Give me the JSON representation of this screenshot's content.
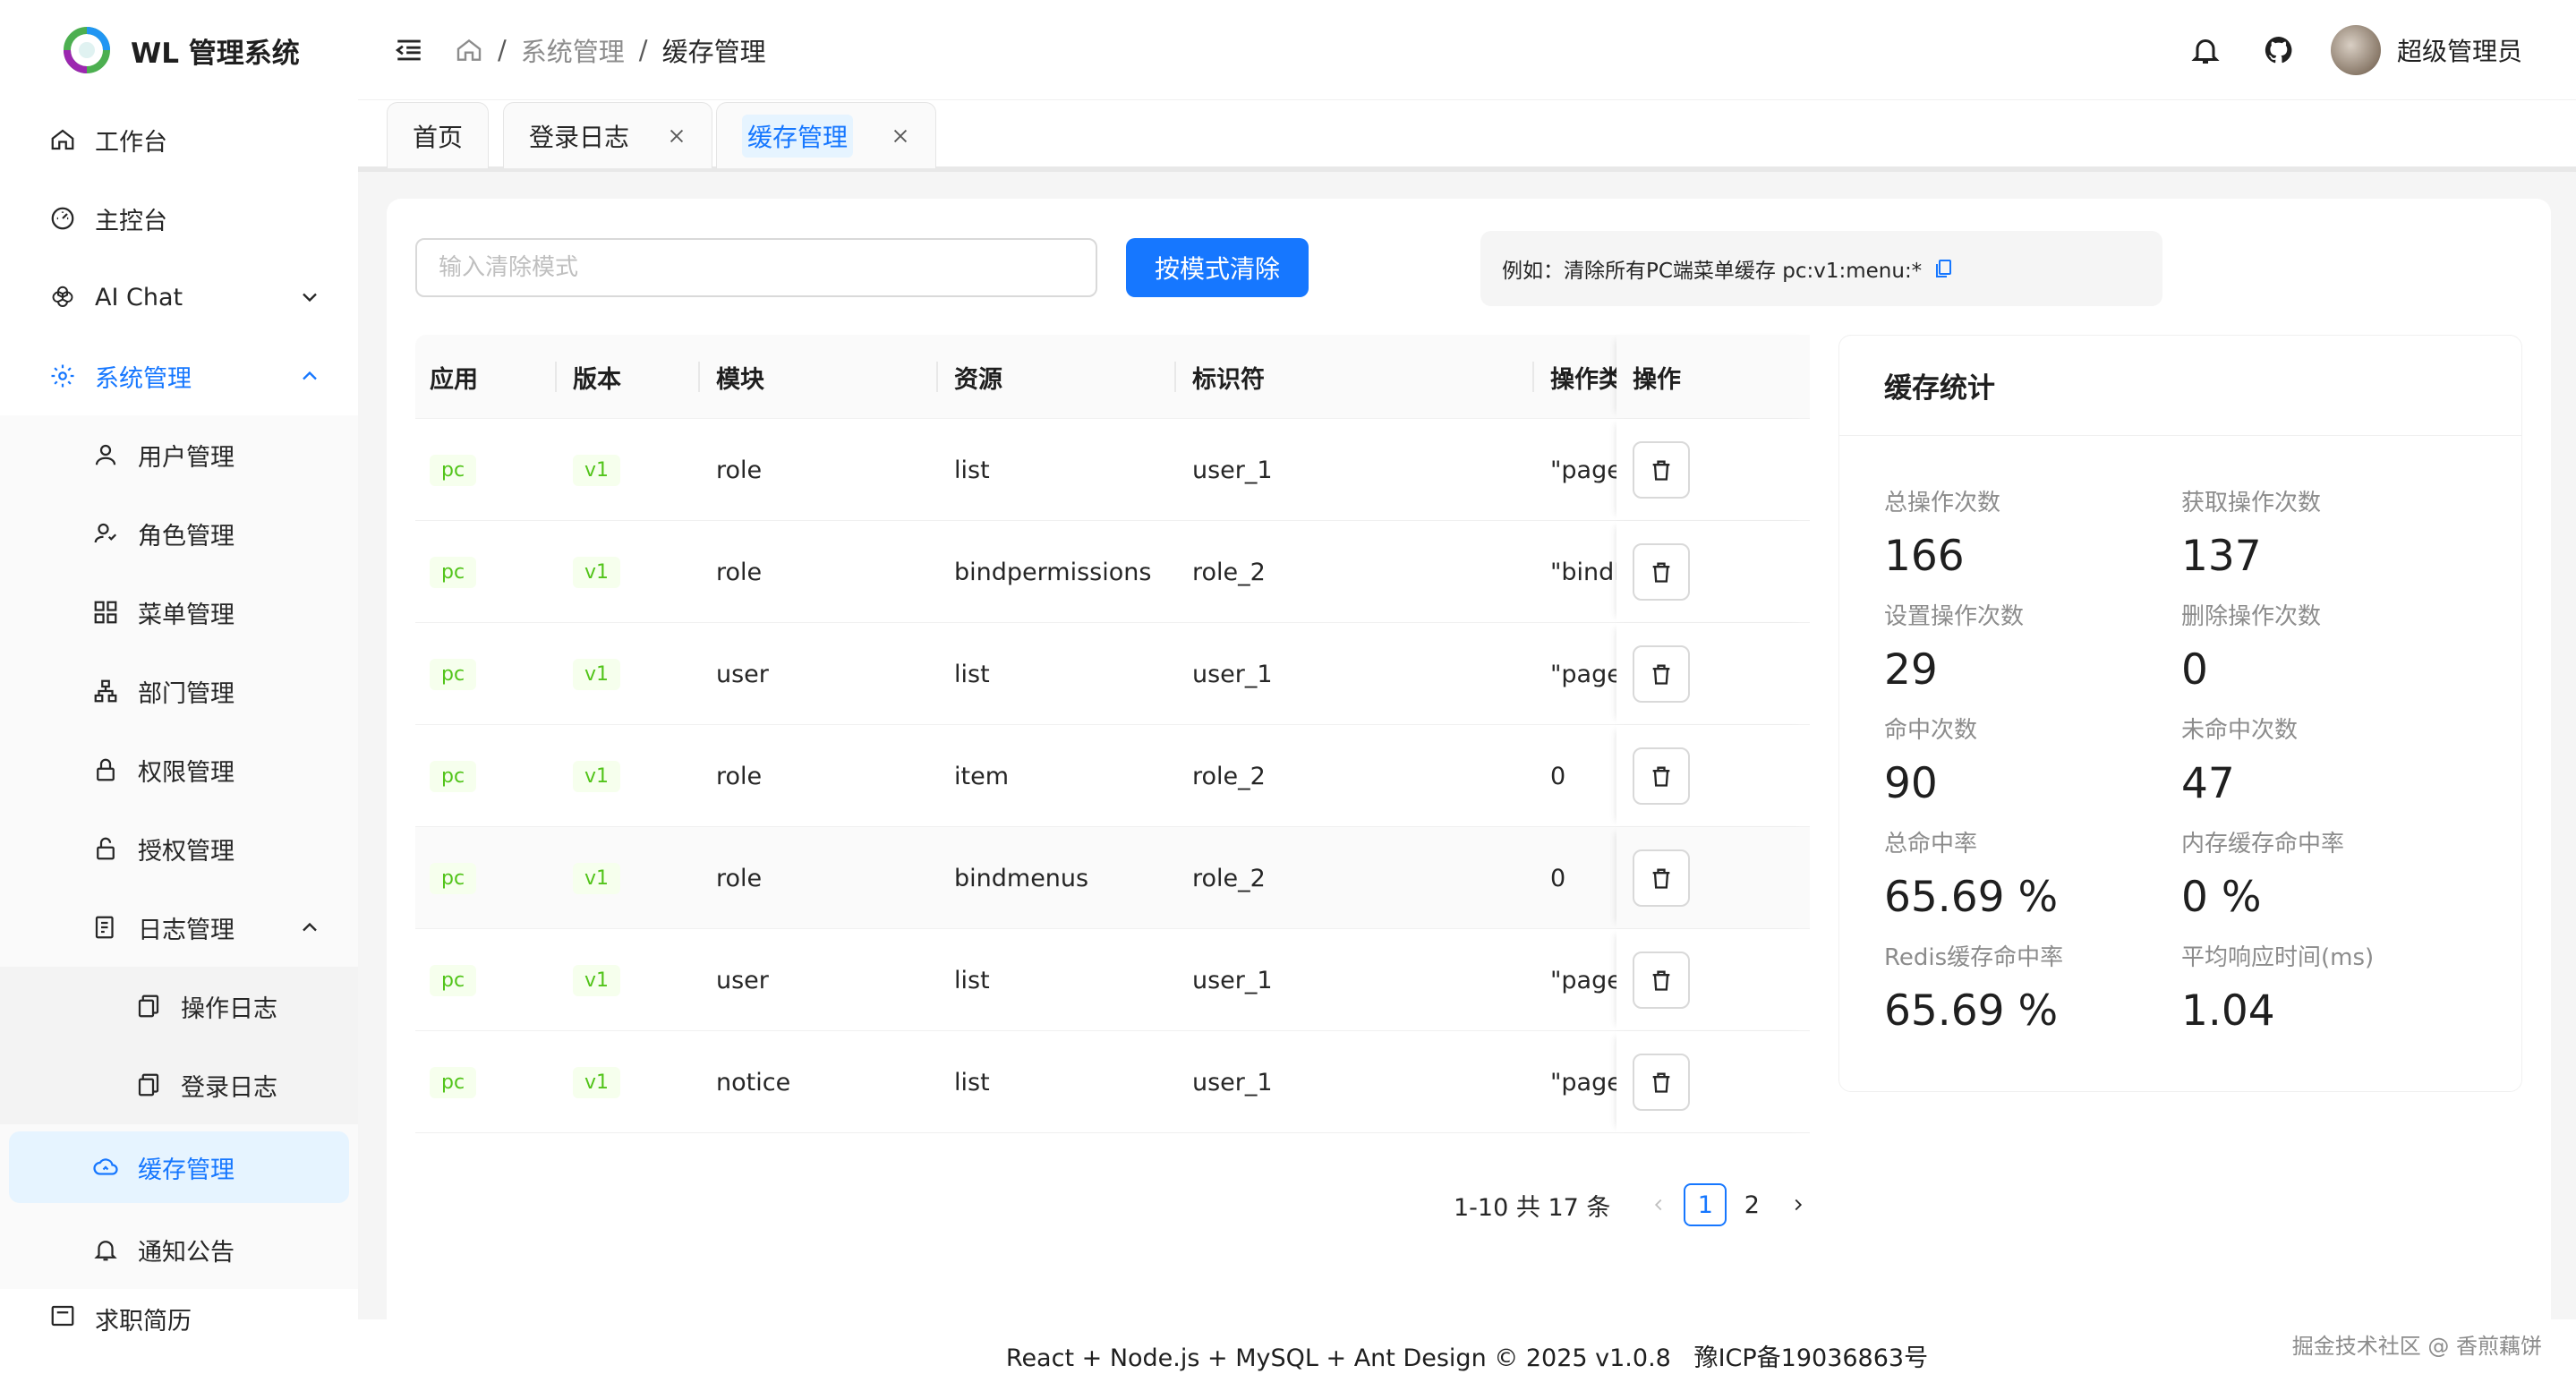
{
  "app": {
    "title": "WL 管理系统"
  },
  "sidebar": {
    "items": [
      {
        "label": "工作台",
        "icon": "home-icon"
      },
      {
        "label": "主控台",
        "icon": "dashboard-icon"
      },
      {
        "label": "AI Chat",
        "icon": "openai-icon"
      },
      {
        "label": "系统管理",
        "icon": "gear-icon"
      }
    ],
    "system": [
      {
        "label": "用户管理",
        "icon": "user-icon"
      },
      {
        "label": "角色管理",
        "icon": "role-icon"
      },
      {
        "label": "菜单管理",
        "icon": "menu-grid-icon"
      },
      {
        "label": "部门管理",
        "icon": "department-icon"
      },
      {
        "label": "权限管理",
        "icon": "lock-icon"
      },
      {
        "label": "授权管理",
        "icon": "unlock-icon"
      },
      {
        "label": "日志管理",
        "icon": "log-icon"
      }
    ],
    "logs": [
      {
        "label": "操作日志",
        "icon": "copy-doc-icon"
      },
      {
        "label": "登录日志",
        "icon": "copy-doc-icon"
      }
    ],
    "cache": {
      "label": "缓存管理",
      "icon": "cloud-icon"
    },
    "notice": {
      "label": "通知公告",
      "icon": "bell-icon"
    },
    "resume": {
      "label": "求职简历",
      "icon": "resume-icon"
    }
  },
  "header": {
    "breadcrumb": [
      "系统管理",
      "缓存管理"
    ],
    "username": "超级管理员"
  },
  "tabs": [
    {
      "label": "首页"
    },
    {
      "label": "登录日志"
    },
    {
      "label": "缓存管理"
    }
  ],
  "toolbar": {
    "search_placeholder": "输入清除模式",
    "clear_label": "按模式清除",
    "example": "例如：清除所有PC端菜单缓存 pc:v1:menu:*"
  },
  "table": {
    "columns": [
      "应用",
      "版本",
      "模块",
      "资源",
      "标识符",
      "操作类",
      "操作"
    ],
    "rows": [
      {
        "app": "pc",
        "version": "v1",
        "module": "role",
        "resource": "list",
        "id": "user_1",
        "op": "\"page"
      },
      {
        "app": "pc",
        "version": "v1",
        "module": "role",
        "resource": "bindpermissions",
        "id": "role_2",
        "op": "\"bindI"
      },
      {
        "app": "pc",
        "version": "v1",
        "module": "user",
        "resource": "list",
        "id": "user_1",
        "op": "\"page"
      },
      {
        "app": "pc",
        "version": "v1",
        "module": "role",
        "resource": "item",
        "id": "role_2",
        "op": "0"
      },
      {
        "app": "pc",
        "version": "v1",
        "module": "role",
        "resource": "bindmenus",
        "id": "role_2",
        "op": "0"
      },
      {
        "app": "pc",
        "version": "v1",
        "module": "user",
        "resource": "list",
        "id": "user_1",
        "op": "\"page"
      },
      {
        "app": "pc",
        "version": "v1",
        "module": "notice",
        "resource": "list",
        "id": "user_1",
        "op": "\"page"
      }
    ]
  },
  "pagination": {
    "total_text": "1-10 共 17 条",
    "pages": [
      "1",
      "2"
    ],
    "current": "1"
  },
  "stats": {
    "title": "缓存统计",
    "items": [
      {
        "label": "总操作次数",
        "value": "166"
      },
      {
        "label": "获取操作次数",
        "value": "137"
      },
      {
        "label": "设置操作次数",
        "value": "29"
      },
      {
        "label": "删除操作次数",
        "value": "0"
      },
      {
        "label": "命中次数",
        "value": "90"
      },
      {
        "label": "未命中次数",
        "value": "47"
      },
      {
        "label": "总命中率",
        "value": "65.69 %"
      },
      {
        "label": "内存缓存命中率",
        "value": "0 %"
      },
      {
        "label": "Redis缓存命中率",
        "value": "65.69 %"
      },
      {
        "label": "平均响应时间(ms)",
        "value": "1.04"
      }
    ]
  },
  "footer": {
    "text": "React + Node.js + MySQL + Ant Design © 2025 v1.0.8   豫ICP备19036863号"
  },
  "watermark": "掘金技术社区 @ 香煎藕饼",
  "colors": {
    "primary": "#1677ff",
    "tag_green": "#52c41a"
  }
}
